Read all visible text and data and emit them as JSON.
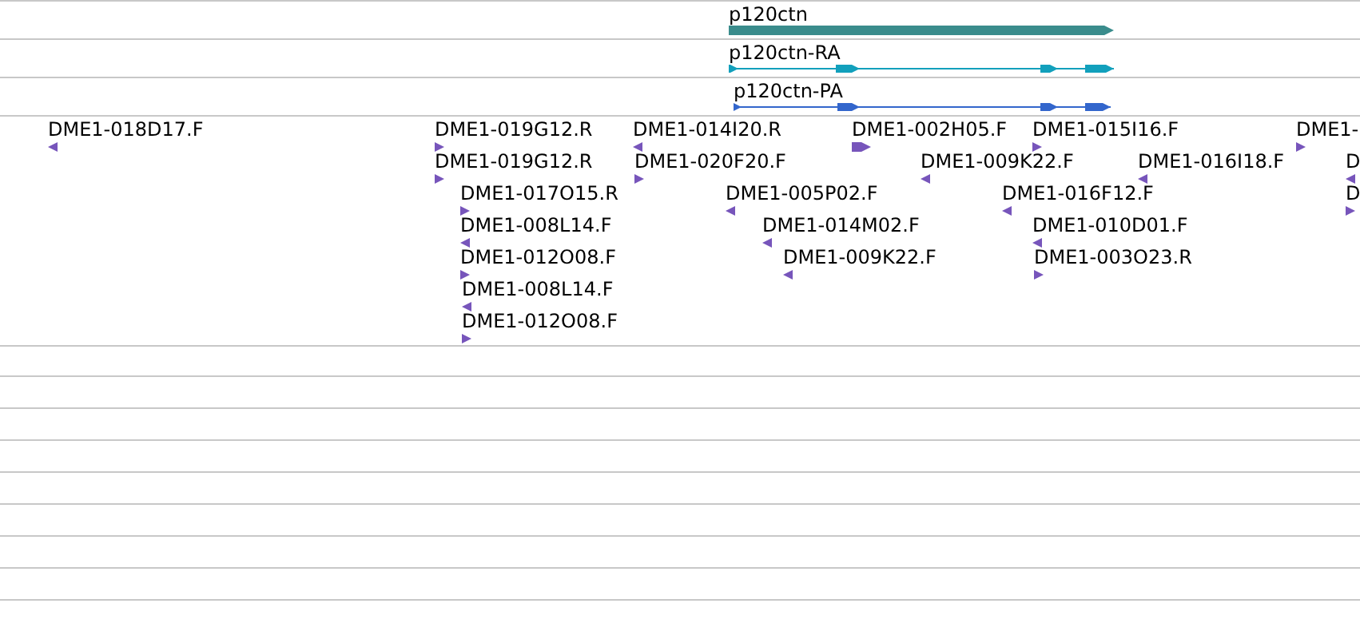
{
  "gene_track": [
    {
      "label": "p120ctn",
      "kind": "gene",
      "color": "#3a8c8c"
    },
    {
      "label": "p120ctn-RA",
      "kind": "transcript",
      "color": "#12a0bc"
    },
    {
      "label": "p120ctn-PA",
      "kind": "transcript",
      "color": "#3366cc"
    }
  ],
  "clones": [
    {
      "label": "DME1-018D17.F",
      "kind": "reverse"
    },
    {
      "label": "DME1-019G12.R",
      "kind": "forward"
    },
    {
      "label": "DME1-014I20.R",
      "kind": "reverse"
    },
    {
      "label": "DME1-002H05.F",
      "kind": "forward"
    },
    {
      "label": "DME1-015I16.F",
      "kind": "forward"
    },
    {
      "label": "DME1-",
      "kind": "forward"
    },
    {
      "label": "DME1-019G12.R",
      "kind": "forward"
    },
    {
      "label": "DME1-020F20.F",
      "kind": "forward"
    },
    {
      "label": "DME1-009K22.F",
      "kind": "reverse"
    },
    {
      "label": "DME1-016I18.F",
      "kind": "reverse"
    },
    {
      "label": "D",
      "kind": "reverse"
    },
    {
      "label": "DME1-017O15.R",
      "kind": "forward"
    },
    {
      "label": "DME1-005P02.F",
      "kind": "reverse"
    },
    {
      "label": "DME1-016F12.F",
      "kind": "reverse"
    },
    {
      "label": "D",
      "kind": "forward"
    },
    {
      "label": "DME1-008L14.F",
      "kind": "reverse"
    },
    {
      "label": "DME1-014M02.F",
      "kind": "reverse"
    },
    {
      "label": "DME1-010D01.F",
      "kind": "reverse"
    },
    {
      "label": "DME1-012O08.F",
      "kind": "forward"
    },
    {
      "label": "DME1-009K22.F",
      "kind": "reverse"
    },
    {
      "label": "DME1-003O23.R",
      "kind": "forward"
    },
    {
      "label": "DME1-008L14.F",
      "kind": "reverse"
    },
    {
      "label": "DME1-012O08.F",
      "kind": "forward"
    }
  ]
}
